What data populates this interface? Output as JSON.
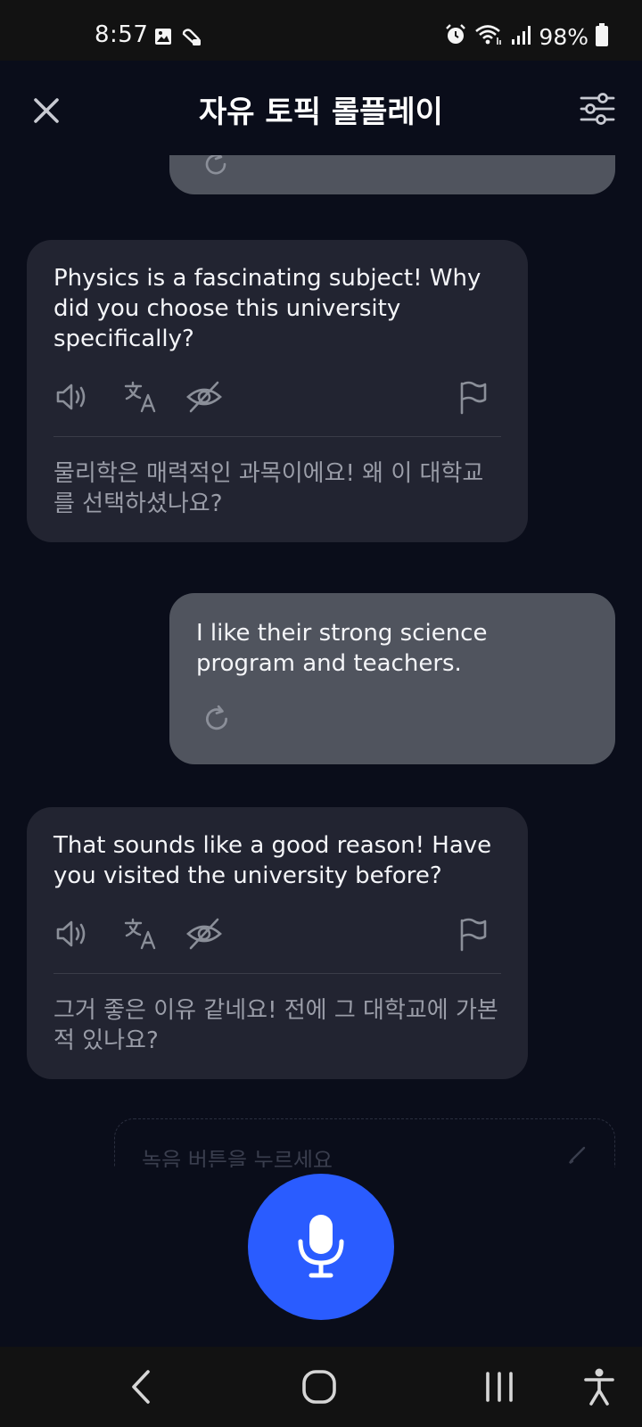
{
  "status_bar": {
    "time": "8:57",
    "battery_pct": "98%",
    "icons": [
      "image-icon",
      "vpn-icon",
      "alarm-icon",
      "wifi-icon",
      "signal-icon",
      "battery-icon"
    ]
  },
  "header": {
    "title": "자유 토픽 롤플레이",
    "close_icon": "close-icon",
    "settings_icon": "sliders-icon"
  },
  "messages": [
    {
      "role": "ai",
      "text": "Physics is a fascinating subject! Why did you choose this university specifically?",
      "translation": "물리학은 매력적인 과목이에요! 왜 이 대학교를 선택하셨나요?"
    },
    {
      "role": "user",
      "text": "I like their strong science program and teachers."
    },
    {
      "role": "ai",
      "text": "That sounds like a good reason! Have you visited the university before?",
      "translation": "그거 좋은 이유 같네요! 전에 그 대학교에 가본 적 있나요?"
    }
  ],
  "input_hint": "녹음 버튼을 누르세요",
  "colors": {
    "background": "#0a0d1a",
    "ai_bubble": "#222431",
    "user_bubble": "#50545e",
    "mic_button": "#2a5cff",
    "secondary_text": "#9a9da8"
  }
}
